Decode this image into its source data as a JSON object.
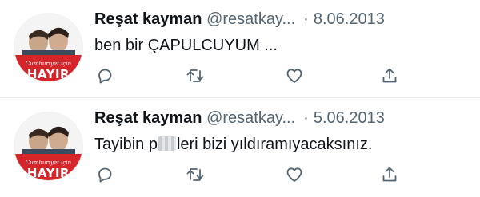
{
  "tweets": [
    {
      "author_name": "Reşat kayman",
      "handle": "@resatkay...",
      "separator": "·",
      "date": "8.06.2013",
      "text_before": "ben bir ÇAPULCUYUM ...",
      "text_blurred": false,
      "text_after": "",
      "avatar_caption_small": "Cumhuriyet için",
      "avatar_caption_big": "HAYIR"
    },
    {
      "author_name": "Reşat kayman",
      "handle": "@resatkay...",
      "separator": "·",
      "date": "5.06.2013",
      "text_before": "Tayibin p",
      "text_blurred": true,
      "text_after": "leri bizi yıldıramıyacaksınız.",
      "avatar_caption_small": "Cumhuriyet için",
      "avatar_caption_big": "HAYIR"
    }
  ],
  "icons": {
    "reply": "reply-icon",
    "retweet": "retweet-icon",
    "like": "like-icon",
    "share": "share-icon"
  },
  "colors": {
    "text_primary": "#0f1419",
    "text_secondary": "#536471",
    "avatar_red": "#d6242b",
    "divider": "#e6ecf0"
  }
}
